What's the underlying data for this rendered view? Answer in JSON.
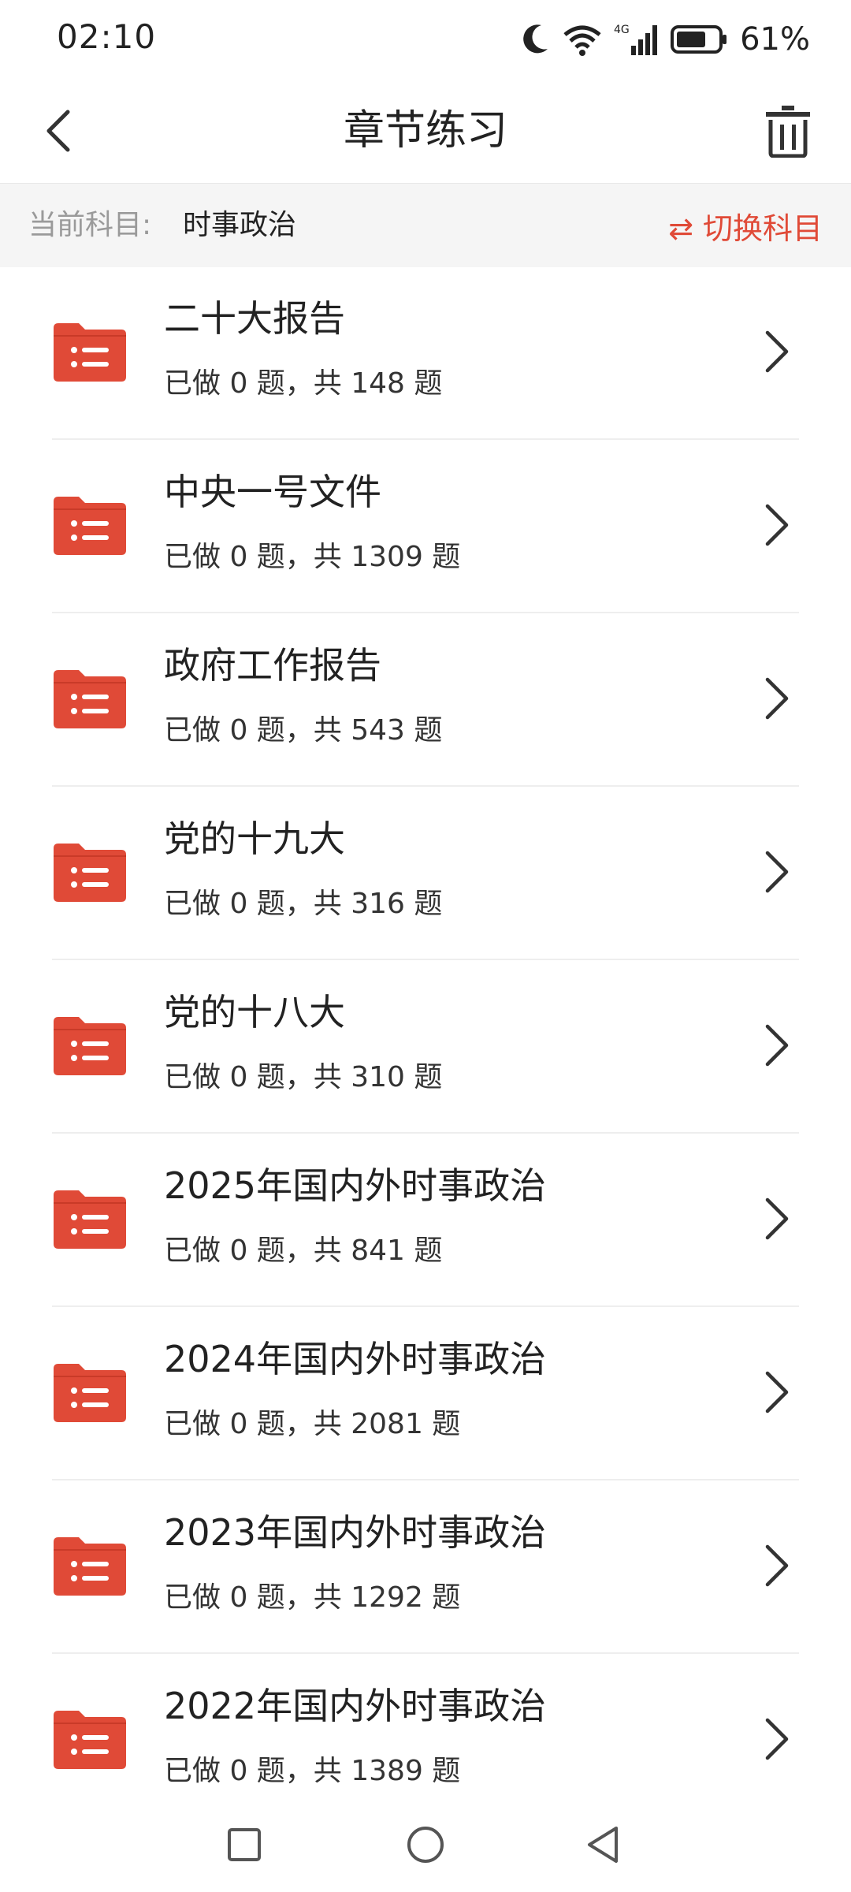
{
  "status_bar": {
    "time": "02:10",
    "battery_percent": "61%",
    "network": "4G"
  },
  "header": {
    "title": "章节练习"
  },
  "subject_bar": {
    "label": "当前科目:",
    "value": "时事政治",
    "switch_label": "⇄ 切换科目"
  },
  "colors": {
    "accent": "#e04a37",
    "folder": "#e04a37"
  },
  "chapters": [
    {
      "title": "二十大报告",
      "progress": "已做 0 题，共 148 题"
    },
    {
      "title": "中央一号文件",
      "progress": "已做 0 题，共 1309 题"
    },
    {
      "title": "政府工作报告",
      "progress": "已做 0 题，共 543 题"
    },
    {
      "title": "党的十九大",
      "progress": "已做 0 题，共 316 题"
    },
    {
      "title": "党的十八大",
      "progress": "已做 0 题，共 310 题"
    },
    {
      "title": "2025年国内外时事政治",
      "progress": "已做 0 题，共 841 题"
    },
    {
      "title": "2024年国内外时事政治",
      "progress": "已做 0 题，共 2081 题"
    },
    {
      "title": "2023年国内外时事政治",
      "progress": "已做 0 题，共 1292 题"
    },
    {
      "title": "2022年国内外时事政治",
      "progress": "已做 0 题，共 1389 题"
    }
  ]
}
